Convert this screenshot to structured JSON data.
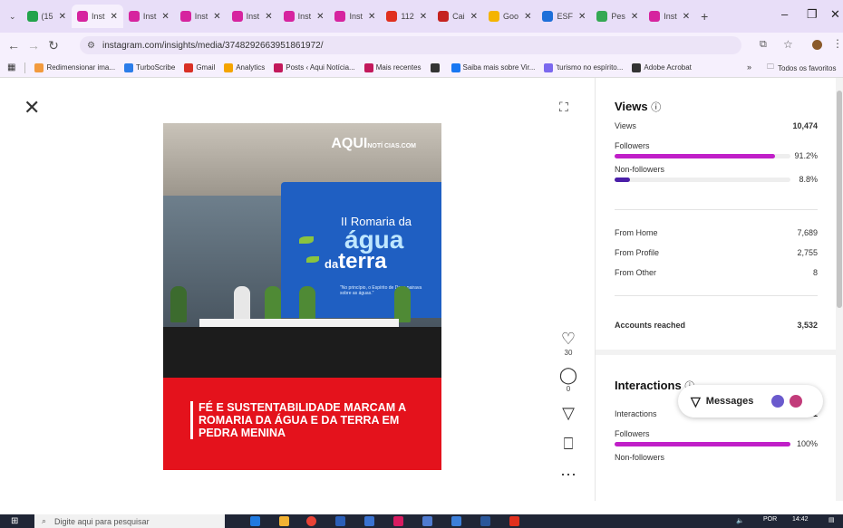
{
  "browser": {
    "tabs": [
      {
        "label": "(15",
        "color": "#22a34b",
        "active": false
      },
      {
        "label": "Inst",
        "color": "#d6249f",
        "active": true
      },
      {
        "label": "Inst",
        "color": "#d6249f",
        "active": false
      },
      {
        "label": "Inst",
        "color": "#d6249f",
        "active": false
      },
      {
        "label": "Inst",
        "color": "#d6249f",
        "active": false
      },
      {
        "label": "Inst",
        "color": "#d6249f",
        "active": false
      },
      {
        "label": "Inst",
        "color": "#d6249f",
        "active": false
      },
      {
        "label": "112",
        "color": "#e0301e",
        "active": false
      },
      {
        "label": "Cai",
        "color": "#c5221f",
        "active": false
      },
      {
        "label": "Goo",
        "color": "#f4b400",
        "active": false
      },
      {
        "label": "ESF",
        "color": "#1e6fd9",
        "active": false
      },
      {
        "label": "Pes",
        "color": "#34a853",
        "active": false
      },
      {
        "label": "Inst",
        "color": "#d6249f",
        "active": false
      }
    ],
    "new_tab": "+",
    "url": "instagram.com/insights/media/3748292663951861972/",
    "bookmarks": [
      {
        "label": "Redimensionar ima...",
        "color": "#f29a3d"
      },
      {
        "label": "TurboScribe",
        "color": "#2b7de9"
      },
      {
        "label": "Gmail",
        "color": "#d93025"
      },
      {
        "label": "Analytics",
        "color": "#f4a400"
      },
      {
        "label": "Posts ‹ Aqui Notícia...",
        "color": "#c2185b"
      },
      {
        "label": "Mais recentes",
        "color": "#c2185b"
      },
      {
        "label": "",
        "color": "#333333"
      },
      {
        "label": "Saiba mais sobre Vir...",
        "color": "#1877f2"
      },
      {
        "label": "'turismo no espírito...",
        "color": "#7b68ee"
      },
      {
        "label": "Adobe Acrobat",
        "color": "#333333"
      }
    ],
    "bookmarks_more": "»",
    "all_bookmarks": "Todos os favoritos"
  },
  "post": {
    "logo": "AQUI",
    "logo_small": "NOTÍ CIAS.COM",
    "banner_line1": "II Romaria da",
    "banner_line2": "água",
    "banner_line3_pre": "da",
    "banner_line3": "terra",
    "banner_quote": "\"No princípio, o Espírito de Deus pairava sobre as águas.\"",
    "headline": "FÉ E SUSTENTABILIDADE MARCAM A ROMARIA DA ÁGUA E DA TERRA EM PEDRA MENINA"
  },
  "actions": {
    "likes": "30",
    "comments": "0"
  },
  "insights": {
    "views_title": "Views",
    "views_label": "Views",
    "views_value": "10,474",
    "followers_label": "Followers",
    "followers_pct": "91.2%",
    "followers_fraction": 0.912,
    "nonfollowers_label": "Non-followers",
    "nonfollowers_pct": "8.8%",
    "nonfollowers_fraction": 0.088,
    "sources": [
      {
        "label": "From Home",
        "value": "7,689"
      },
      {
        "label": "From Profile",
        "value": "2,755"
      },
      {
        "label": "From Other",
        "value": "8"
      }
    ],
    "reached_label": "Accounts reached",
    "reached_value": "3,532",
    "interactions_title": "Interactions",
    "interactions_label": "Interactions",
    "interactions_value": "31",
    "int_followers_label": "Followers",
    "int_followers_pct": "100%",
    "int_followers_fraction": 1.0,
    "int_nonfollowers_label": "Non-followers",
    "bar_followers_color": "#c01fc8",
    "bar_nonfollowers_color": "#4b1fa8"
  },
  "messages": {
    "label": "Messages"
  },
  "taskbar": {
    "search_placeholder": "Digite aqui para pesquisar",
    "lang": "POR",
    "time": "14:42"
  }
}
